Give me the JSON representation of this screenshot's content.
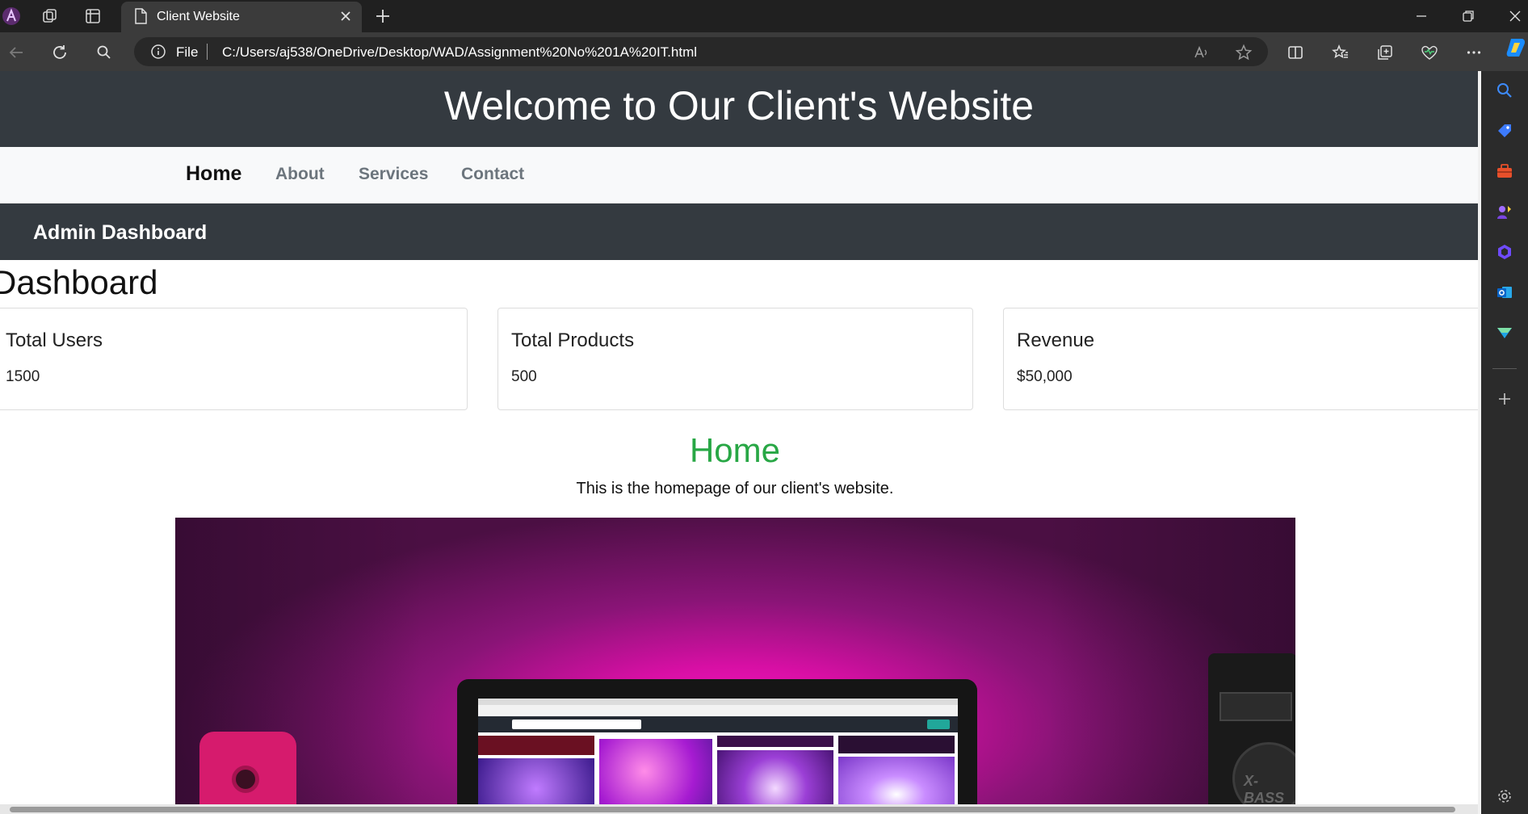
{
  "browser": {
    "tab_title": "Client Website",
    "url_scheme_label": "File",
    "url": "C:/Users/aj538/OneDrive/Desktop/WAD/Assignment%20No%201A%20IT.html",
    "icons": {
      "profile": "profile-icon",
      "workspaces": "workspaces-icon",
      "tab_actions": "tab-actions-icon",
      "page": "page-icon",
      "close_tab": "close-icon",
      "new_tab": "plus-icon",
      "minimize": "minimize-icon",
      "restore": "restore-icon",
      "close_window": "close-icon",
      "back": "back-arrow-icon",
      "refresh": "refresh-icon",
      "search": "search-icon",
      "info": "info-icon",
      "read_aloud": "read-aloud-icon",
      "favorite": "star-icon",
      "split_screen": "split-screen-icon",
      "favorites": "favorites-icon",
      "collections": "collections-icon",
      "performance": "heartbeat-icon",
      "more": "more-icon"
    },
    "accent_color": "#0078d4"
  },
  "page": {
    "header_title": "Welcome to Our Client's Website",
    "nav": [
      {
        "label": "Home",
        "active": true
      },
      {
        "label": "About",
        "active": false
      },
      {
        "label": "Services",
        "active": false
      },
      {
        "label": "Contact",
        "active": false
      }
    ],
    "admin_title": "Admin Dashboard",
    "dashboard_title": "Dashboard",
    "cards": [
      {
        "title": "Total Users",
        "value": "1500"
      },
      {
        "title": "Total Products",
        "value": "500"
      },
      {
        "title": "Revenue",
        "value": "$50,000"
      }
    ],
    "section_heading": "Home",
    "section_text": "This is the homepage of our client's website.",
    "hero_image": {
      "speaker_brand": "X-BASS"
    },
    "colors": {
      "header_bg": "#343a40",
      "nav_bg": "#f8f9fa",
      "heading_green": "#28a745"
    }
  },
  "sidebar": {
    "icons": [
      "search-icon",
      "tag-icon",
      "toolbox-icon",
      "games-icon",
      "copilot-icon",
      "outlook-icon",
      "drop-icon",
      "plus-icon",
      "settings-icon"
    ]
  }
}
